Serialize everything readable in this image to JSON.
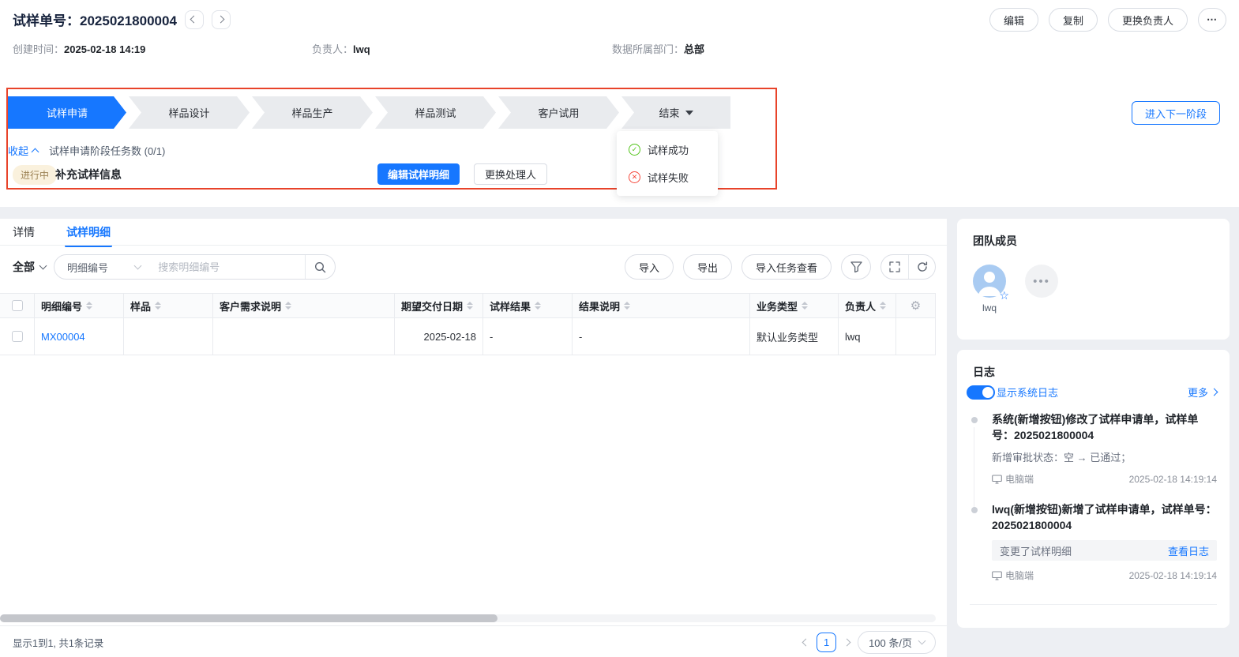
{
  "colors": {
    "primary": "#1677ff",
    "annotation_red": "#e8432a",
    "success_green": "#52c41a",
    "danger_red": "#f5483b",
    "badge_bg": "#faf1dd",
    "badge_text": "#9c8254"
  },
  "header": {
    "title_label": "试样单号：",
    "title_value": "2025021800004",
    "actions": {
      "edit": "编辑",
      "copy": "复制",
      "change_owner": "更换负责人",
      "more": "⋯"
    },
    "fields": [
      {
        "label": "创建时间：",
        "value": "2025-02-18 14:19"
      },
      {
        "label": "负责人：",
        "value": "lwq"
      },
      {
        "label": "数据所属部门：",
        "value": "总部"
      }
    ]
  },
  "stages": {
    "items": [
      {
        "label": "试样申请",
        "state": "active"
      },
      {
        "label": "样品设计",
        "state": "upcoming"
      },
      {
        "label": "样品生产",
        "state": "upcoming"
      },
      {
        "label": "样品测试",
        "state": "upcoming"
      },
      {
        "label": "客户试用",
        "state": "upcoming"
      },
      {
        "label": "结束",
        "state": "upcoming"
      }
    ],
    "dropdown": [
      {
        "label": "试样成功",
        "icon": "check-circle"
      },
      {
        "label": "试样失败",
        "icon": "close-circle"
      }
    ],
    "collapse_label": "收起",
    "tasks_summary": "试样申请阶段任务数 (0/1)",
    "status_badge": "进行中",
    "task_name": "补充试样信息",
    "edit_detail_button": "编辑试样明细",
    "change_handler_button": "更换处理人",
    "next_stage_button": "进入下一阶段"
  },
  "tabs": [
    {
      "label": "详情",
      "active": false
    },
    {
      "label": "试样明细",
      "active": true
    }
  ],
  "toolbar": {
    "scope_label": "全部",
    "field_select_value": "明细编号",
    "search_placeholder": "搜索明细编号",
    "import_button": "导入",
    "export_button": "导出",
    "import_task_button": "导入任务查看"
  },
  "table": {
    "columns": [
      "明细编号",
      "样品",
      "客户需求说明",
      "期望交付日期",
      "试样结果",
      "结果说明",
      "业务类型",
      "负责人"
    ],
    "rows": [
      {
        "cells": [
          "MX00004",
          "",
          "",
          "2025-02-18",
          "-",
          "-",
          "默认业务类型",
          "lwq"
        ]
      }
    ]
  },
  "table_footer": {
    "summary": "显示1到1, 共1条记录",
    "current_page": "1",
    "page_size": "100 条/页"
  },
  "team": {
    "title": "团队成员",
    "members": [
      {
        "name": "lwq"
      }
    ]
  },
  "logs": {
    "title": "日志",
    "toggle_label": "显示系统日志",
    "more_label": "更多",
    "entries": [
      {
        "title": "系统(新增按钮)修改了试样申请单，试样单号：2025021800004",
        "detail": "新增审批状态：空 → 已通过；",
        "device": "电脑端",
        "time": "2025-02-18 14:19:14"
      },
      {
        "title": "lwq(新增按钮)新增了试样申请单，试样单号：2025021800004",
        "change_label": "变更了试样明细",
        "change_link": "查看日志",
        "device": "电脑端",
        "time": "2025-02-18 14:19:14"
      }
    ]
  }
}
